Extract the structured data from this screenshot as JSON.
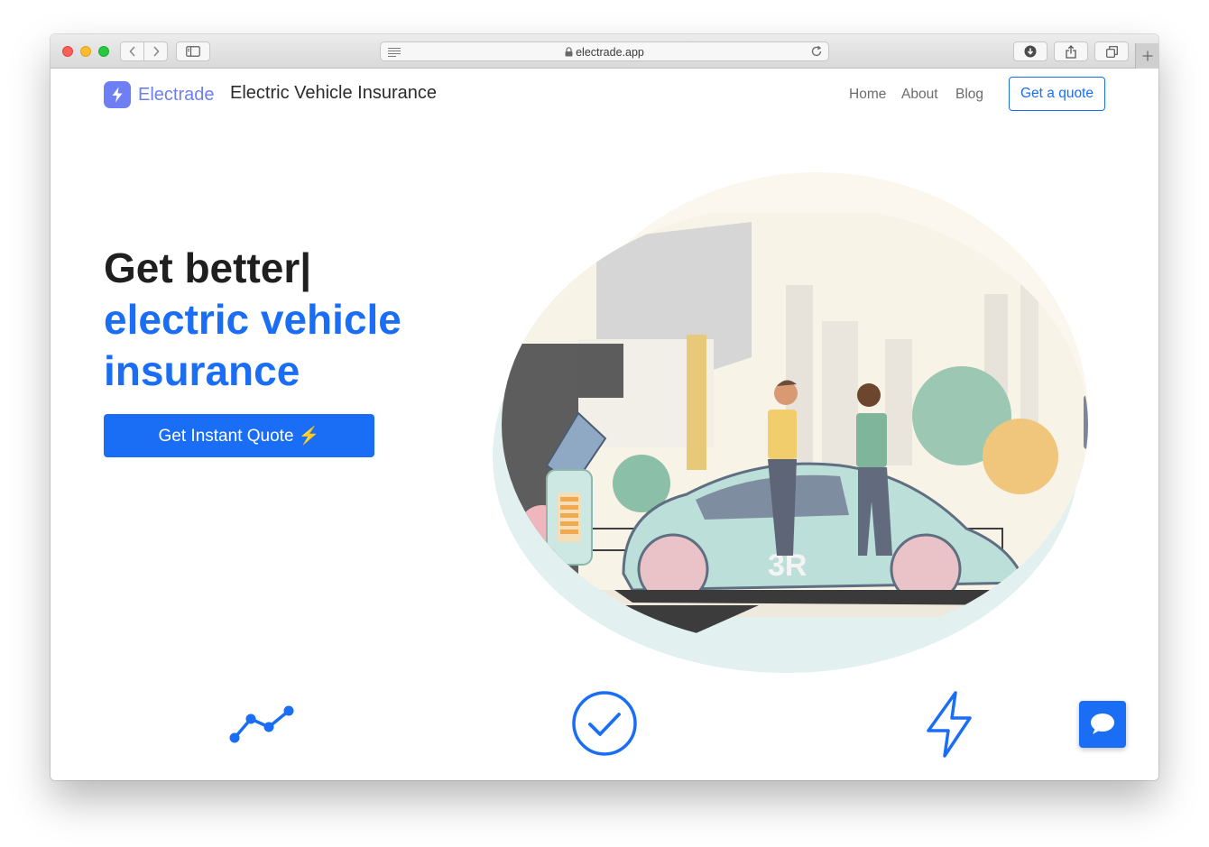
{
  "browser": {
    "url": "electrade.app"
  },
  "header": {
    "brand_name": "Electrade",
    "tagline": "Electric Vehicle Insurance",
    "nav": {
      "home": "Home",
      "about": "About",
      "blog": "Blog"
    },
    "quote_button": "Get a quote"
  },
  "hero": {
    "headline_line1": "Get better|",
    "headline_line2": "electric vehicle",
    "headline_line3": "insurance",
    "cta_label": "Get Instant Quote ⚡",
    "illustration_text": "3R"
  },
  "features": {
    "icons": [
      "trend-chart-icon",
      "check-circle-icon",
      "lightning-bolt-icon"
    ]
  },
  "colors": {
    "brand": "#6e7ff3",
    "accent": "#1a6ef5",
    "heading": "#1f1f1f"
  }
}
